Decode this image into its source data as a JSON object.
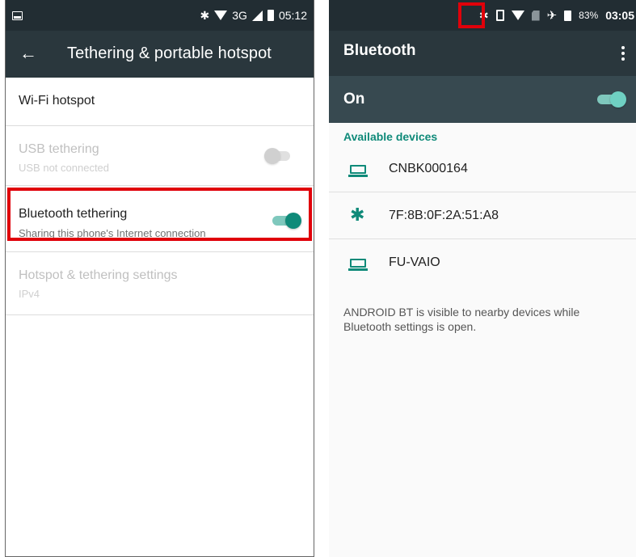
{
  "left_screen": {
    "status_bar": {
      "icons": [
        "notification-icon",
        "bluetooth-icon",
        "wifi-icon",
        "network-3g",
        "signal-icon",
        "battery-icon"
      ],
      "network": "3G",
      "time": "05:12"
    },
    "toolbar": {
      "back_icon": "arrow-back-icon",
      "title": "Tethering & portable hotspot"
    },
    "items": [
      {
        "title": "Wi-Fi hotspot",
        "subtitle": "",
        "enabled": true
      },
      {
        "title": "USB tethering",
        "subtitle": "USB not connected",
        "enabled": false,
        "switch": "off"
      },
      {
        "title": "Bluetooth tethering",
        "subtitle": "Sharing this phone's Internet connection",
        "enabled": true,
        "switch": "on",
        "highlighted": true
      },
      {
        "title": "Hotspot & tethering settings",
        "subtitle": "IPv4",
        "enabled": false
      }
    ]
  },
  "right_screen": {
    "status_bar": {
      "icons": [
        "bluetooth-icon",
        "vibrate-icon",
        "wifi-icon",
        "no-sim-icon",
        "airplane-icon",
        "battery-icon"
      ],
      "battery": "83%",
      "time": "03:05",
      "bluetooth_highlighted": true
    },
    "toolbar": {
      "title": "Bluetooth",
      "menu_icon": "more-vert-icon"
    },
    "master_switch": {
      "label": "On",
      "state": "on"
    },
    "section_header": "Available devices",
    "devices": [
      {
        "name": "CNBK000164",
        "icon": "laptop-icon"
      },
      {
        "name": "7F:8B:0F:2A:51:A8",
        "icon": "bluetooth-icon"
      },
      {
        "name": "FU-VAIO",
        "icon": "laptop-icon"
      }
    ],
    "footnote": "ANDROID BT is visible to nearby devices while Bluetooth settings is open."
  },
  "colors": {
    "status_bar": "#222d33",
    "toolbar": "#2a373d",
    "switch_bar": "#374950",
    "accent": "#0f8a79",
    "highlight": "#e0000a"
  }
}
